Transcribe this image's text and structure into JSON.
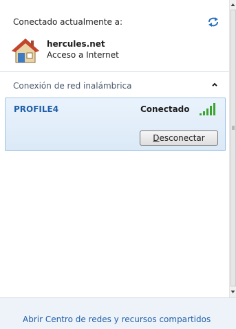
{
  "header": {
    "label": "Conectado actualmente a:",
    "refresh_icon": "refresh-icon"
  },
  "current_network": {
    "name": "hercules.net",
    "status": "Acceso a Internet",
    "icon": "house-icon"
  },
  "wireless_section": {
    "label": "Conexión de red inalámbrica",
    "collapse_icon": "chevron-up-icon",
    "profile": {
      "name": "PROFILE4",
      "state": "Conectado",
      "signal_icon": "signal-strength-icon",
      "button_access_key": "D",
      "button_rest": "esconectar"
    }
  },
  "footer": {
    "link": "Abrir Centro de redes y recursos compartidos"
  },
  "colors": {
    "accent_text": "#1f5fa8",
    "card_border": "#9fc2e3",
    "signal_green": "#3aa52e",
    "footer_bg": "#eef3f9"
  }
}
